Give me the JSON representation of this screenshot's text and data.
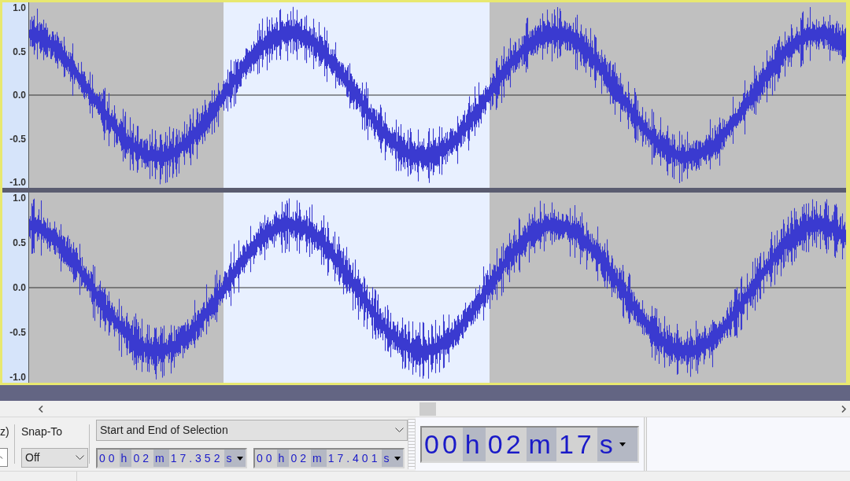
{
  "tracks": [
    {
      "axis_labels": [
        "1.0",
        "0.5",
        "0.0",
        "-0.5",
        "-1.0"
      ]
    },
    {
      "axis_labels": [
        "1.0",
        "0.5",
        "0.0",
        "-0.5",
        "-1.0"
      ]
    }
  ],
  "selection_toolbar": {
    "partial_label": "z)",
    "snap_to_label": "Snap-To",
    "snap_to_value": "Off",
    "selection_mode": "Start and End of Selection",
    "start_time": [
      {
        "text": "00",
        "kind": "digits"
      },
      {
        "text": "h",
        "kind": "unit"
      },
      {
        "text": "02",
        "kind": "digits"
      },
      {
        "text": "m",
        "kind": "unit"
      },
      {
        "text": "17.352",
        "kind": "digits"
      },
      {
        "text": "s",
        "kind": "unit"
      }
    ],
    "end_time": [
      {
        "text": "00",
        "kind": "digits"
      },
      {
        "text": "h",
        "kind": "unit"
      },
      {
        "text": "02",
        "kind": "digits"
      },
      {
        "text": "m",
        "kind": "unit"
      },
      {
        "text": "17.401",
        "kind": "digits"
      },
      {
        "text": "s",
        "kind": "unit"
      }
    ]
  },
  "time_toolbar": {
    "time": [
      {
        "text": "00",
        "kind": "digits"
      },
      {
        "text": "h",
        "kind": "unit"
      },
      {
        "text": "02",
        "kind": "digits"
      },
      {
        "text": "m",
        "kind": "unit"
      },
      {
        "text": "17",
        "kind": "digits"
      },
      {
        "text": "s",
        "kind": "unit"
      }
    ]
  }
}
